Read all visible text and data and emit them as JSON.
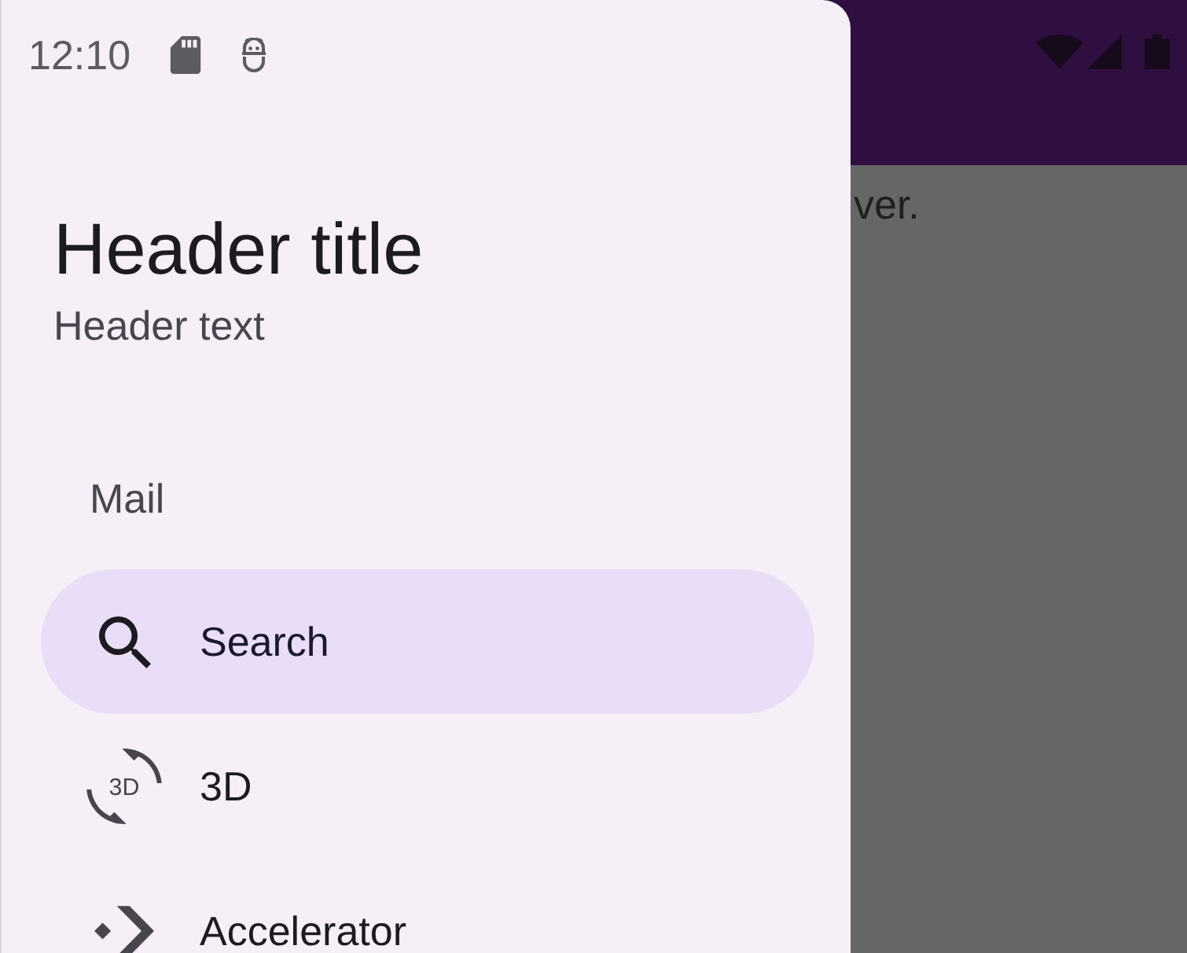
{
  "status_bar": {
    "time": "12:10"
  },
  "drawer": {
    "header": {
      "title": "Header title",
      "text": "Header text"
    },
    "section_label": "Mail",
    "items": [
      {
        "label": "Search",
        "selected": true
      },
      {
        "label": "3D",
        "icon_text": "3D",
        "selected": false
      },
      {
        "label": "Accelerator",
        "selected": false
      }
    ]
  },
  "content": {
    "text": "ver."
  }
}
